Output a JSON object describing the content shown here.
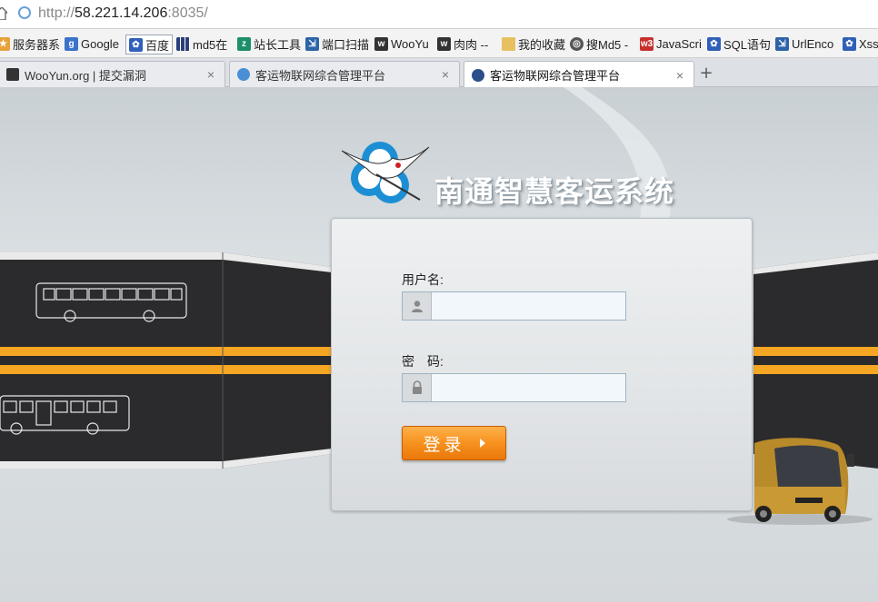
{
  "browser": {
    "url_scheme": "http://",
    "url_host": "58.221.14.206",
    "url_rest": ":8035/",
    "bookmarks": [
      {
        "label": "服务器系",
        "icon": "star-icon",
        "color": "#e8a23a"
      },
      {
        "label": "Google",
        "icon": "google-icon",
        "color": "#3b74c9"
      },
      {
        "label": "百度",
        "icon": "baidu-paw-icon",
        "color": "#2f5fb8"
      },
      {
        "label": "md5在",
        "icon": "grid-icon",
        "color": "#333333"
      },
      {
        "label": "站长工具",
        "icon": "chinaz-icon",
        "color": "#1b8f6a"
      },
      {
        "label": "端口扫描",
        "icon": "scan-icon",
        "color": "#2d64a8"
      },
      {
        "label": "WooYu",
        "icon": "wooyun-icon",
        "color": "#333333"
      },
      {
        "label": "肉肉 --",
        "icon": "wooyun-icon",
        "color": "#333333"
      },
      {
        "label": "我的收藏",
        "icon": "folder-icon",
        "color": "#e8c060"
      },
      {
        "label": "搜Md5 -",
        "icon": "globe-icon",
        "color": "#555555"
      },
      {
        "label": "JavaScri",
        "icon": "w3-icon",
        "color": "#c8302c"
      },
      {
        "label": "SQL语句",
        "icon": "baidu-paw-icon",
        "color": "#2f5fb8"
      },
      {
        "label": "UrlEnco",
        "icon": "scan-icon",
        "color": "#2d64a8"
      },
      {
        "label": "Xss",
        "icon": "baidu-paw-icon",
        "color": "#2f5fb8"
      }
    ],
    "tabs": [
      {
        "label": "WooYun.org | 提交漏洞",
        "close": "×",
        "active": false
      },
      {
        "label": "客运物联网综合管理平台",
        "close": "×",
        "active": false
      },
      {
        "label": "客运物联网综合管理平台",
        "close": "×",
        "active": true
      }
    ],
    "new_tab": "+"
  },
  "page": {
    "system_title": "南通智慧客运系统",
    "username_label": "用户名:",
    "username_value": "",
    "password_label": "密　码:",
    "password_value": "",
    "login_button": "登录",
    "colors": {
      "band_dark": "#2b2a2c",
      "stripe_orange": "#f5a623",
      "button_orange": "#f7911f",
      "logo_blue": "#1c8fd4"
    }
  }
}
